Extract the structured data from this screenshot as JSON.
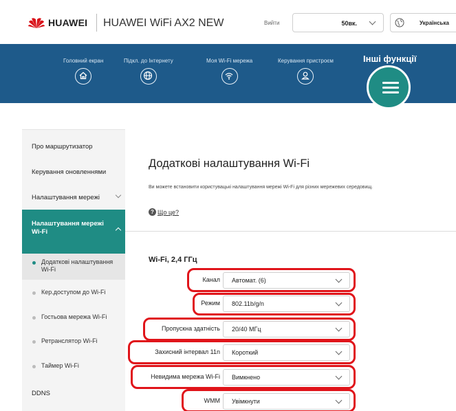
{
  "header": {
    "brand": "HUAWEI",
    "product": "HUAWEI WiFi AX2 NEW",
    "login_label": "Вийти",
    "login_value": "50вк.",
    "language": "Українська"
  },
  "nav": {
    "items": [
      {
        "label": "Головний екран",
        "icon": "home-icon"
      },
      {
        "label": "Підкл. до Інтернету",
        "icon": "globe-icon"
      },
      {
        "label": "Моя Wi-Fi мережа",
        "icon": "wifi-icon"
      },
      {
        "label": "Керування пристроєм",
        "icon": "user-icon"
      }
    ],
    "more_label": "Інші функції",
    "menu_icon": "hamburger-menu-icon"
  },
  "sidebar": {
    "items": [
      {
        "label": "Про маршрутизатор"
      },
      {
        "label": "Керування оновленнями"
      },
      {
        "label": "Налаштування мережі"
      },
      {
        "label_line1": "Налаштування мережі",
        "label_line2": "Wi-Fi"
      },
      {
        "label": "DDNS"
      }
    ],
    "subitems": [
      {
        "label_line1": "Додаткові налаштування",
        "label_line2": "Wi-Fi"
      },
      {
        "label": "Кер.доступом до Wi-Fi"
      },
      {
        "label": "Гостьова мережа Wi-Fi"
      },
      {
        "label": "Ретранслятор Wi-Fi"
      },
      {
        "label": "Таймер Wi-Fi"
      }
    ]
  },
  "content": {
    "title": "Додаткові налаштування Wi-Fi",
    "description": "Ви можете встановити користувацькі налаштування мережі Wi-Fi для різних мережевих середовищ.",
    "help_link": "Що це?",
    "section_title": "Wi-Fi, 2,4 ГГц",
    "settings": [
      {
        "label": "Канал",
        "value": "Автомат. (6)"
      },
      {
        "label": "Режим",
        "value": "802.11b/g/n"
      },
      {
        "label": "Пропускна здатність",
        "value": "20/40 МГц"
      },
      {
        "label": "Захисний інтервал 11n",
        "value": "Короткий"
      },
      {
        "label": "Невидима мережа Wi-Fi",
        "value": "Вимкнено"
      },
      {
        "label": "WMM",
        "value": "Увімкнути"
      }
    ]
  },
  "colors": {
    "nav_bg": "#1e5a8a",
    "accent": "#1f8c84",
    "annotation": "#e0141a"
  }
}
